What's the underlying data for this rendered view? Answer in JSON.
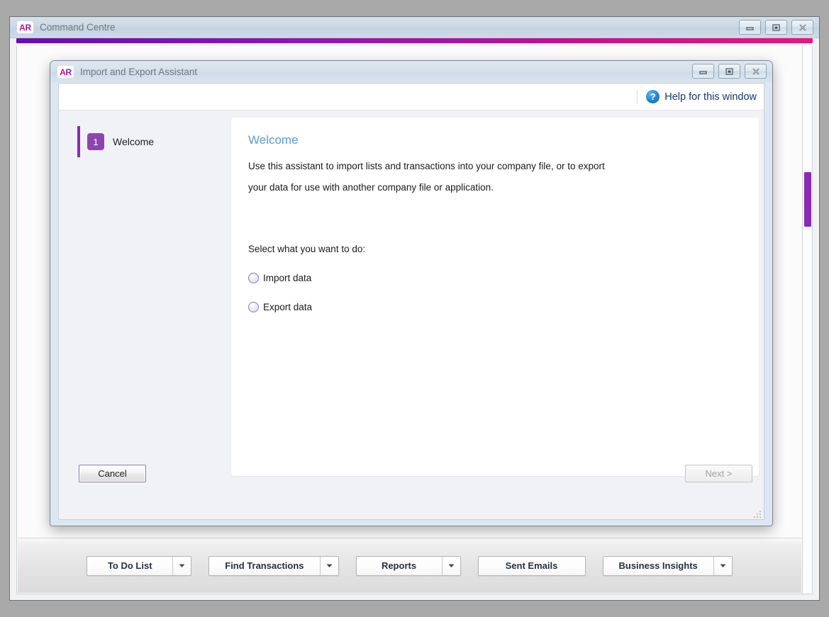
{
  "app": {
    "logo": {
      "first": "A",
      "second": "R",
      "icon_name": "ar-logo-icon"
    },
    "title": "Command Centre",
    "window_controls": {
      "minimize": "minimize-icon",
      "maximize": "maximize-icon",
      "close": "close-icon"
    },
    "accent_colors": {
      "purple": "#6a0dad",
      "magenta": "#e8157f"
    }
  },
  "dialog": {
    "logo": {
      "first": "A",
      "second": "R"
    },
    "title": "Import and Export Assistant",
    "window_controls": {
      "minimize": "minimize-icon",
      "maximize": "maximize-icon",
      "close": "close-icon"
    },
    "help": {
      "icon": "question-mark-icon",
      "icon_glyph": "?",
      "label": "Help for this window"
    },
    "steps": [
      {
        "number": "1",
        "label": "Welcome",
        "active": true
      }
    ],
    "content": {
      "heading": "Welcome",
      "paragraph_line1": "Use this assistant to import lists and transactions into your company file, or to export",
      "paragraph_line2": "your data for use with another company file or application.",
      "prompt": "Select what you want to do:",
      "options": [
        {
          "label": "Import data",
          "selected": false
        },
        {
          "label": "Export data",
          "selected": false
        }
      ]
    },
    "footer": {
      "cancel_label": "Cancel",
      "next_label": "Next >",
      "next_disabled": true,
      "resize_grip": "resize-grip-icon"
    }
  },
  "toolbar": {
    "buttons": [
      {
        "label": "To Do List",
        "has_dropdown": true
      },
      {
        "label": "Find Transactions",
        "has_dropdown": true
      },
      {
        "label": "Reports",
        "has_dropdown": true
      },
      {
        "label": "Sent Emails",
        "has_dropdown": false
      },
      {
        "label": "Business Insights",
        "has_dropdown": true
      }
    ]
  },
  "background_window": {
    "scrollbar": {
      "thumb_color": "#8a2ab5"
    }
  }
}
